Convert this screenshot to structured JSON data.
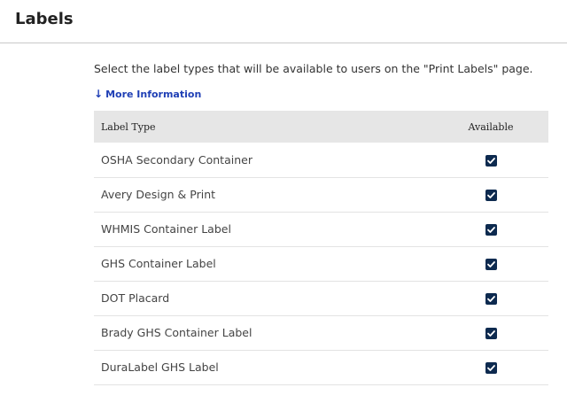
{
  "header": {
    "title": "Labels"
  },
  "main": {
    "description": "Select the label types that will be available to users on the \"Print Labels\" page.",
    "more_info_label": "More Information",
    "table": {
      "columns": [
        "Label Type",
        "Available"
      ],
      "rows": [
        {
          "label": "OSHA Secondary Container",
          "available": true
        },
        {
          "label": "Avery Design & Print",
          "available": true
        },
        {
          "label": "WHMIS Container Label",
          "available": true
        },
        {
          "label": "GHS Container Label",
          "available": true
        },
        {
          "label": "DOT Placard",
          "available": true
        },
        {
          "label": "Brady GHS Container Label",
          "available": true
        },
        {
          "label": "DuraLabel GHS Label",
          "available": true
        }
      ]
    }
  },
  "colors": {
    "checkbox_fill": "#0d2a4f",
    "link": "#1f3fb5",
    "header_row_bg": "#e6e6e6"
  },
  "icons": {
    "more_info": "arrow-down-icon",
    "checkbox": "checkmark-icon"
  }
}
